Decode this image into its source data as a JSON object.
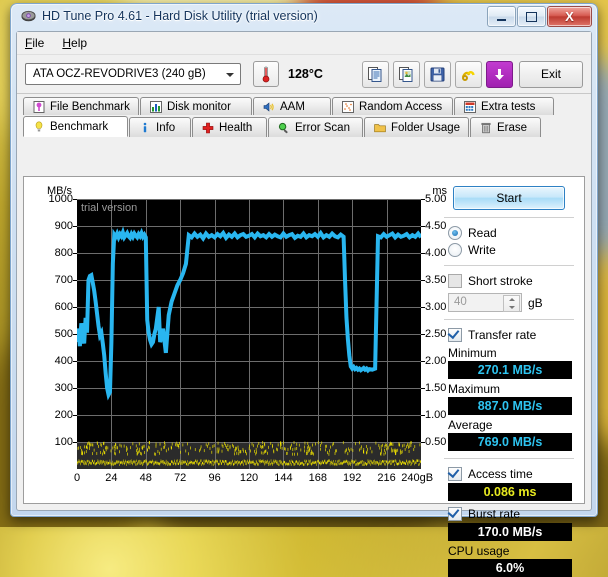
{
  "window": {
    "title": "HD Tune Pro 4.61 - Hard Disk Utility (trial version)",
    "icon": "hard-disk-icon",
    "minimize": "–",
    "maximize": "□",
    "close": "X"
  },
  "menu": {
    "items": [
      "File",
      "Help"
    ]
  },
  "toolbar": {
    "drive": "ATA    OCZ-REVODRIVE3   (240 gB)",
    "temperature": "128°C",
    "buttons": [
      "copy-icon",
      "copy-image-icon",
      "save-icon",
      "folder-link-icon",
      "download-icon"
    ],
    "exit": "Exit"
  },
  "tabs_row1": [
    {
      "label": "File Benchmark",
      "icon": "file-benchmark-icon"
    },
    {
      "label": "Disk monitor",
      "icon": "bar-chart-icon"
    },
    {
      "label": "AAM",
      "icon": "speaker-icon"
    },
    {
      "label": "Random Access",
      "icon": "scatter-icon"
    },
    {
      "label": "Extra tests",
      "icon": "extra-tests-icon"
    }
  ],
  "tabs_row2": [
    {
      "label": "Benchmark",
      "icon": "lightbulb-icon",
      "active": true
    },
    {
      "label": "Info",
      "icon": "info-icon",
      "active": false
    },
    {
      "label": "Health",
      "icon": "red-cross-icon",
      "active": false
    },
    {
      "label": "Error Scan",
      "icon": "magnifier-icon",
      "active": false
    },
    {
      "label": "Folder Usage",
      "icon": "folder-icon",
      "active": false
    },
    {
      "label": "Erase",
      "icon": "trash-icon",
      "active": false
    }
  ],
  "controls": {
    "start": "Start",
    "mode_read": "Read",
    "mode_write": "Write",
    "mode_selected": "Read",
    "short_stroke": "Short stroke",
    "short_stroke_checked": false,
    "short_stroke_value": "40",
    "short_stroke_unit": "gB",
    "transfer_rate": "Transfer rate",
    "transfer_rate_checked": true,
    "minimum_label": "Minimum",
    "minimum_value": "270.1 MB/s",
    "maximum_label": "Maximum",
    "maximum_value": "887.0 MB/s",
    "average_label": "Average",
    "average_value": "769.0 MB/s",
    "access_time_label": "Access time",
    "access_time_checked": true,
    "access_time_value": "0.086 ms",
    "burst_rate_label": "Burst rate",
    "burst_rate_checked": true,
    "burst_rate_value": "170.0 MB/s",
    "cpu_usage_label": "CPU usage",
    "cpu_usage_value": "6.0%"
  },
  "chart_data": {
    "type": "line",
    "title": "",
    "watermark": "trial version",
    "ylabel": "MB/s",
    "y2label": "ms",
    "xlabel": "gB",
    "ylim": [
      0,
      1000
    ],
    "y2lim": [
      0.0,
      5.0
    ],
    "xlim": [
      0,
      240
    ],
    "yticks": [
      100,
      200,
      300,
      400,
      500,
      600,
      700,
      800,
      900,
      1000
    ],
    "y2ticks": [
      "0.50",
      "1.00",
      "1.50",
      "2.00",
      "2.50",
      "3.00",
      "3.50",
      "4.00",
      "4.50",
      "5.00"
    ],
    "xticks": [
      0,
      24,
      48,
      72,
      96,
      120,
      144,
      168,
      192,
      216,
      240
    ],
    "xtick_last_suffix": "240gB",
    "grid": true,
    "legend": "none",
    "series": [
      {
        "name": "Transfer rate",
        "color": "#29b6f0",
        "unit": "MB/s",
        "axis": "left",
        "x": [
          0,
          1,
          2,
          3,
          4,
          5,
          6,
          7,
          8,
          9,
          10,
          11,
          12,
          13,
          14,
          15,
          16,
          17,
          18,
          19,
          20,
          21,
          22,
          23,
          24,
          25,
          26,
          27,
          28,
          29,
          30,
          31,
          32,
          33,
          34,
          35,
          36,
          37,
          38,
          39,
          40,
          41,
          42,
          43,
          44,
          45,
          46,
          47,
          48,
          49,
          50,
          51,
          52,
          53,
          54,
          55,
          56,
          57,
          58,
          59,
          60,
          62,
          64,
          66,
          68,
          70,
          72,
          74,
          76,
          78,
          80,
          82,
          84,
          86,
          88,
          90,
          92,
          94,
          96,
          98,
          100,
          102,
          104,
          106,
          108,
          110,
          112,
          114,
          116,
          118,
          120,
          122,
          124,
          126,
          128,
          130,
          132,
          134,
          136,
          138,
          140,
          142,
          144,
          146,
          148,
          150,
          152,
          154,
          156,
          158,
          160,
          162,
          164,
          166,
          168,
          170,
          172,
          174,
          176,
          178,
          180,
          182,
          184,
          186,
          187,
          188,
          189,
          190,
          191,
          192,
          193,
          194,
          195,
          196,
          197,
          198,
          199,
          200,
          201,
          202,
          203,
          204,
          206,
          208,
          210,
          212,
          214,
          216,
          218,
          220,
          222,
          224,
          226,
          228,
          230,
          232,
          234,
          236,
          238,
          240
        ],
        "y": [
          470,
          520,
          455,
          540,
          490,
          465,
          560,
          505,
          700,
          715,
          718,
          690,
          660,
          620,
          575,
          530,
          495,
          505,
          465,
          420,
          355,
          300,
          275,
          285,
          470,
          760,
          868,
          860,
          872,
          858,
          870,
          862,
          876,
          858,
          866,
          874,
          862,
          856,
          870,
          860,
          872,
          864,
          858,
          870,
          862,
          874,
          860,
          868,
          858,
          552,
          505,
          478,
          462,
          470,
          500,
          520,
          560,
          600,
          470,
          490,
          520,
          430,
          570,
          620,
          650,
          680,
          700,
          725,
          760,
          866,
          858,
          872,
          860,
          868,
          854,
          872,
          860,
          866,
          858,
          870,
          862,
          874,
          856,
          868,
          860,
          872,
          858,
          866,
          870,
          860,
          864,
          870,
          858,
          872,
          862,
          866,
          858,
          870,
          860,
          868,
          862,
          858,
          872,
          860,
          866,
          870,
          856,
          864,
          860,
          872,
          858,
          866,
          862,
          870,
          860,
          874,
          858,
          866,
          860,
          872,
          862,
          858,
          868,
          860,
          700,
          560,
          480,
          420,
          380,
          372,
          378,
          370,
          374,
          368,
          372,
          366,
          370,
          374,
          368,
          372,
          365,
          370,
          368,
          372,
          862,
          858,
          870,
          860,
          866,
          872,
          858,
          868,
          860,
          864,
          870,
          858,
          866,
          860,
          872,
          858
        ]
      },
      {
        "name": "Access time",
        "color": "#f5e800",
        "unit": "ms",
        "axis": "right",
        "note": "yellow scatter points clustered near 0.30-0.45 ms with a dense baseline near 0.08 ms across the full span"
      }
    ]
  }
}
